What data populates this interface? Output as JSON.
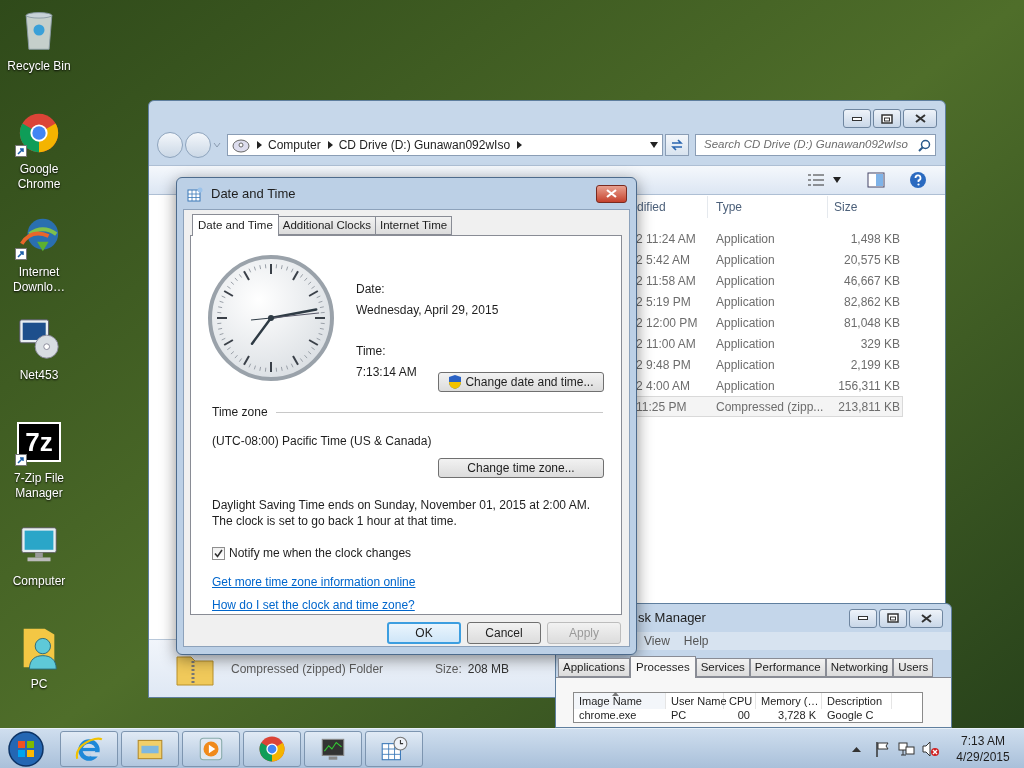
{
  "desktop_icons": [
    {
      "kind": "recycle-bin",
      "label": "Recycle Bin",
      "shortcut": false
    },
    {
      "kind": "chrome",
      "label": "Google Chrome",
      "shortcut": true
    },
    {
      "kind": "download-globe",
      "label": "Internet Downlo…",
      "shortcut": true
    },
    {
      "kind": "installer",
      "label": "Net453",
      "shortcut": false
    },
    {
      "kind": "archive",
      "label": "7-Zip File Manager",
      "logo_text": "7z",
      "shortcut": true
    },
    {
      "kind": "computer",
      "label": "Computer",
      "shortcut": false
    },
    {
      "kind": "user-folder",
      "label": "PC",
      "shortcut": false
    }
  ],
  "explorer": {
    "breadcrumb": [
      "Computer",
      "CD Drive (D:) Gunawan092wIso"
    ],
    "search_placeholder": "Search CD Drive (D:) Gunawan092wIso",
    "columns": [
      "dified",
      "Type",
      "Size"
    ],
    "rows": [
      {
        "modified": "2 11:24 AM",
        "type": "Application",
        "size": "1,498 KB",
        "selected": false
      },
      {
        "modified": "2 5:42 AM",
        "type": "Application",
        "size": "20,575 KB",
        "selected": false
      },
      {
        "modified": "2 11:58 AM",
        "type": "Application",
        "size": "46,667 KB",
        "selected": false
      },
      {
        "modified": "2 5:19 PM",
        "type": "Application",
        "size": "82,862 KB",
        "selected": false
      },
      {
        "modified": "2 12:00 PM",
        "type": "Application",
        "size": "81,048 KB",
        "selected": false
      },
      {
        "modified": "2 11:00 AM",
        "type": "Application",
        "size": "329 KB",
        "selected": false
      },
      {
        "modified": "2 9:48 PM",
        "type": "Application",
        "size": "2,199 KB",
        "selected": false
      },
      {
        "modified": "2 4:00 AM",
        "type": "Application",
        "size": "156,311 KB",
        "selected": false
      },
      {
        "modified": "11:25 PM",
        "type": "Compressed (zipp...",
        "size": "213,811 KB",
        "selected": true
      }
    ],
    "details": {
      "type": "Compressed (zipped) Folder",
      "size_label": "Size:",
      "size": "208 MB"
    }
  },
  "date_dialog": {
    "title": "Date and Time",
    "tabs": [
      {
        "label": "Date and Time",
        "selected": true
      },
      {
        "label": "Additional Clocks",
        "selected": false
      },
      {
        "label": "Internet Time",
        "selected": false
      }
    ],
    "date_label": "Date:",
    "date": "Wednesday, April 29, 2015",
    "time_label": "Time:",
    "time": "7:13:14 AM",
    "change_datetime_button": "Change date and time...",
    "time_zone_heading": "Time zone",
    "time_zone": "(UTC-08:00) Pacific Time (US & Canada)",
    "change_time_zone_button": "Change time zone...",
    "dst_notice": "Daylight Saving Time ends on Sunday, November 01, 2015 at 2:00 AM. The clock is set to go back 1 hour at that time.",
    "notify": {
      "label": "Notify me when the clock changes",
      "checked": true
    },
    "links": [
      "Get more time zone information online",
      "How do I set the clock and time zone?"
    ],
    "buttons": [
      {
        "label": "OK",
        "default": true,
        "disabled": false
      },
      {
        "label": "Cancel",
        "default": false,
        "disabled": false
      },
      {
        "label": "Apply",
        "default": false,
        "disabled": true
      }
    ]
  },
  "task_manager": {
    "title": "sk Manager",
    "menu": [
      "View",
      "Help"
    ],
    "tabs": [
      {
        "label": "Applications",
        "selected": false
      },
      {
        "label": "Processes",
        "selected": true
      },
      {
        "label": "Services",
        "selected": false
      },
      {
        "label": "Performance",
        "selected": false
      },
      {
        "label": "Networking",
        "selected": false
      },
      {
        "label": "Users",
        "selected": false
      }
    ],
    "columns": [
      "Image Name",
      "User Name",
      "CPU",
      "Memory (…",
      "Description"
    ],
    "rows": [
      {
        "cells": [
          "chrome.exe",
          "PC",
          "00",
          "3,728 K",
          "Google C"
        ]
      }
    ]
  },
  "taskbar": {
    "buttons": [
      {
        "kind": "ie"
      },
      {
        "kind": "explorer"
      },
      {
        "kind": "media"
      },
      {
        "kind": "chrome"
      },
      {
        "kind": "task-manager"
      },
      {
        "kind": "date-time"
      }
    ],
    "time": "7:13 AM",
    "date": "4/29/2015"
  }
}
